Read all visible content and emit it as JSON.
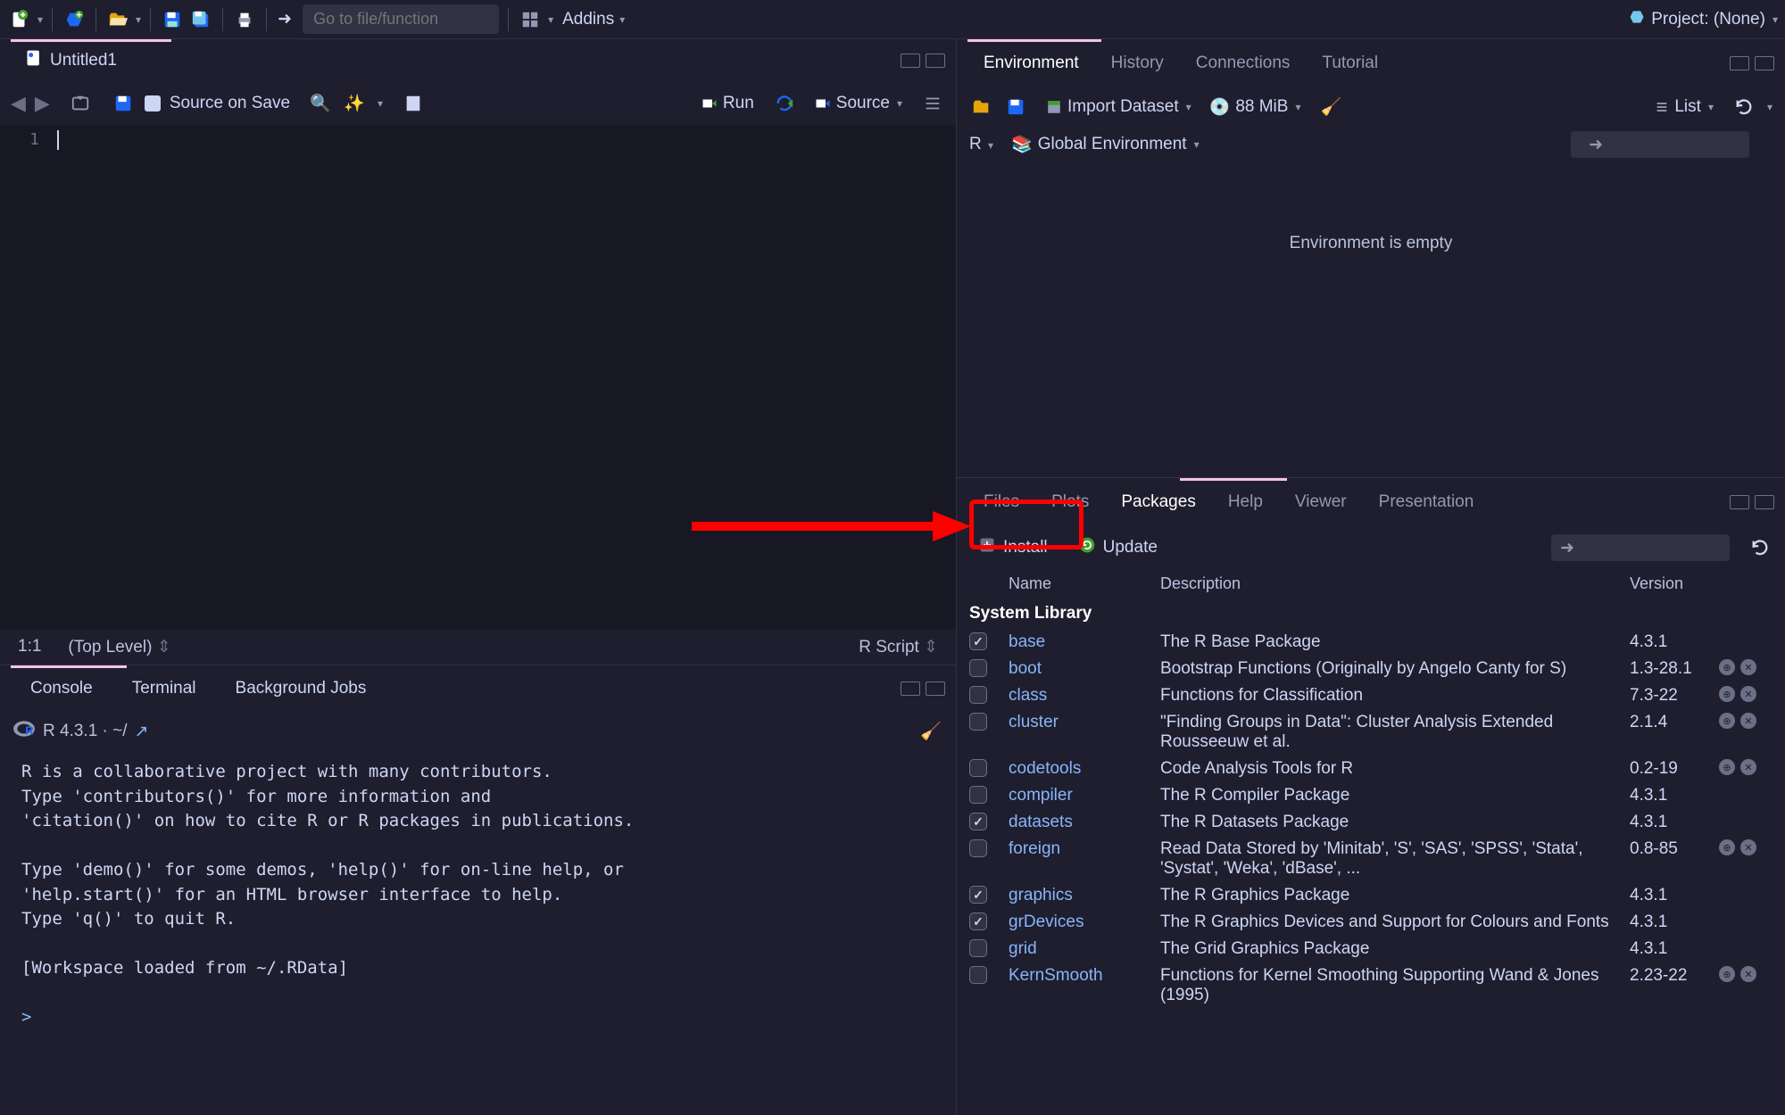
{
  "toolbar": {
    "goto_placeholder": "Go to file/function",
    "addins_label": "Addins",
    "project_label": "Project: (None)"
  },
  "source": {
    "tab_title": "Untitled1",
    "save_on_source": "Source on Save",
    "run_label": "Run",
    "source_label": "Source",
    "line_number": "1",
    "cursor_pos": "1:1",
    "scope": "(Top Level)",
    "file_type": "R Script"
  },
  "console": {
    "tabs": [
      "Console",
      "Terminal",
      "Background Jobs"
    ],
    "version": "R 4.3.1 · ~/",
    "body": "R is a collaborative project with many contributors.\nType 'contributors()' for more information and\n'citation()' on how to cite R or R packages in publications.\n\nType 'demo()' for some demos, 'help()' for on-line help, or\n'help.start()' for an HTML browser interface to help.\nType 'q()' to quit R.\n\n[Workspace loaded from ~/.RData]\n",
    "prompt": ">"
  },
  "env": {
    "tabs": [
      "Environment",
      "History",
      "Connections",
      "Tutorial"
    ],
    "import_label": "Import Dataset",
    "memory": "88 MiB",
    "list_label": "List",
    "lang": "R",
    "scope": "Global Environment",
    "empty_msg": "Environment is empty"
  },
  "pkg": {
    "tabs": [
      "Files",
      "Plots",
      "Packages",
      "Help",
      "Viewer",
      "Presentation"
    ],
    "install_label": "Install",
    "update_label": "Update",
    "col_name": "Name",
    "col_desc": "Description",
    "col_ver": "Version",
    "section": "System Library",
    "rows": [
      {
        "checked": true,
        "name": "base",
        "desc": "The R Base Package",
        "ver": "4.3.1",
        "actions": false
      },
      {
        "checked": false,
        "name": "boot",
        "desc": "Bootstrap Functions (Originally by Angelo Canty for S)",
        "ver": "1.3-28.1",
        "actions": true
      },
      {
        "checked": false,
        "name": "class",
        "desc": "Functions for Classification",
        "ver": "7.3-22",
        "actions": true
      },
      {
        "checked": false,
        "name": "cluster",
        "desc": "\"Finding Groups in Data\": Cluster Analysis Extended Rousseeuw et al.",
        "ver": "2.1.4",
        "actions": true
      },
      {
        "checked": false,
        "name": "codetools",
        "desc": "Code Analysis Tools for R",
        "ver": "0.2-19",
        "actions": true
      },
      {
        "checked": false,
        "name": "compiler",
        "desc": "The R Compiler Package",
        "ver": "4.3.1",
        "actions": false
      },
      {
        "checked": true,
        "name": "datasets",
        "desc": "The R Datasets Package",
        "ver": "4.3.1",
        "actions": false
      },
      {
        "checked": false,
        "name": "foreign",
        "desc": "Read Data Stored by 'Minitab', 'S', 'SAS', 'SPSS', 'Stata', 'Systat', 'Weka', 'dBase', ...",
        "ver": "0.8-85",
        "actions": true
      },
      {
        "checked": true,
        "name": "graphics",
        "desc": "The R Graphics Package",
        "ver": "4.3.1",
        "actions": false
      },
      {
        "checked": true,
        "name": "grDevices",
        "desc": "The R Graphics Devices and Support for Colours and Fonts",
        "ver": "4.3.1",
        "actions": false
      },
      {
        "checked": false,
        "name": "grid",
        "desc": "The Grid Graphics Package",
        "ver": "4.3.1",
        "actions": false
      },
      {
        "checked": false,
        "name": "KernSmooth",
        "desc": "Functions for Kernel Smoothing Supporting Wand & Jones (1995)",
        "ver": "2.23-22",
        "actions": true
      }
    ]
  }
}
